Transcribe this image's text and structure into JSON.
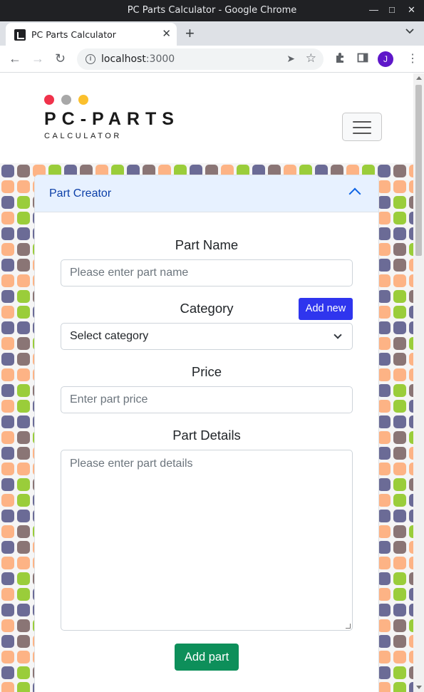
{
  "window": {
    "title": "PC Parts Calculator - Google Chrome",
    "controls": [
      "minimize-icon",
      "maximize-icon",
      "close-icon"
    ]
  },
  "tabs": [
    {
      "title": "PC Parts Calculator",
      "icon": "app-favicon-icon"
    }
  ],
  "toolbar": {
    "url_host": "localhost",
    "url_port": ":3000",
    "profile_initial": "J"
  },
  "site": {
    "logo": {
      "wordmark": "PC-PARTS",
      "subtitle": "CALCULATOR",
      "dot_colors": [
        "#f0324b",
        "#a8a8a8",
        "#fbc02d"
      ]
    },
    "menu_icon": "hamburger-icon"
  },
  "part_creator": {
    "header": "Part Creator",
    "expanded": true,
    "part_name": {
      "label": "Part Name",
      "placeholder": "Please enter part name"
    },
    "category": {
      "label": "Category",
      "selected": "Select category",
      "add_new_label": "Add new"
    },
    "price": {
      "label": "Price",
      "placeholder": "Enter part price"
    },
    "details": {
      "label": "Part Details",
      "placeholder": "Please enter part details"
    },
    "submit_label": "Add part"
  },
  "colors": {
    "accent_blue": "#2f35ee",
    "success_green": "#0d8f5a",
    "header_bg": "#e7f1ff",
    "pattern": [
      "#6b6b96",
      "#9acd3a",
      "#fdb385",
      "#8a7575"
    ]
  }
}
